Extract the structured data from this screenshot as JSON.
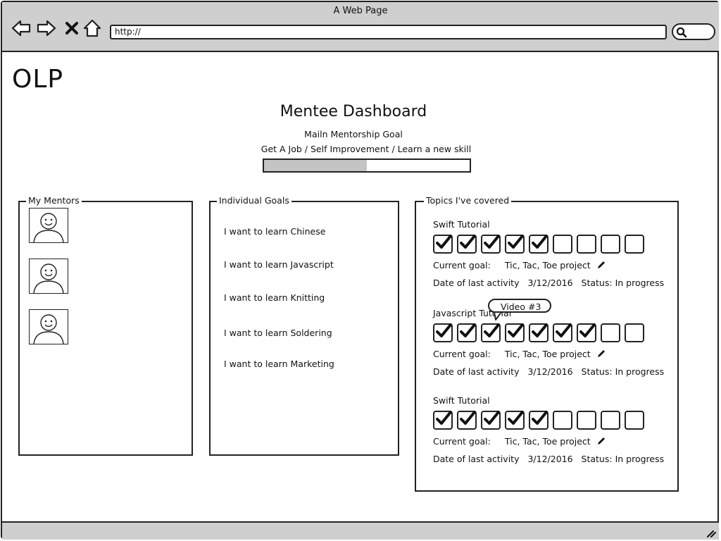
{
  "window": {
    "title": "A Web Page",
    "url": "http://"
  },
  "app": {
    "logo": "OLP",
    "dashboard_title": "Mentee Dashboard",
    "main_goal_label": "Mailn Mentorship Goal",
    "main_goal_text": "Get A Job  / Self Improvement / Learn a new skill",
    "main_goal_progress": 0.5
  },
  "mentors": {
    "legend": "My Mentors",
    "count": 3
  },
  "goals": {
    "legend": "Individual Goals",
    "items": [
      "I want to learn Chinese",
      "I want to learn Javascript",
      "I want to learn Knitting",
      "I want to learn Soldering",
      "I want to learn Marketing"
    ]
  },
  "topics": {
    "legend": "Topics I've covered",
    "items": [
      {
        "title": "Swift Tutorial",
        "checked": 5,
        "total": 9,
        "current_goal_label": "Current goal:",
        "current_goal": "Tic, Tac, Toe project",
        "date_label": "Date of last activity",
        "date": "3/12/2016",
        "status_label": "Status:",
        "status": "In progress"
      },
      {
        "title": "Javascript Tutorial",
        "checked": 7,
        "total": 9,
        "current_goal_label": "Current goal:",
        "current_goal": "Tic, Tac, Toe project",
        "date_label": "Date of last activity",
        "date": "3/12/2016",
        "status_label": "Status:",
        "status": "In progress"
      },
      {
        "title": "Swift Tutorial",
        "checked": 5,
        "total": 9,
        "current_goal_label": "Current goal:",
        "current_goal": "Tic, Tac, Toe project",
        "date_label": "Date of last activity",
        "date": "3/12/2016",
        "status_label": "Status:",
        "status": "In progress"
      }
    ],
    "tooltip": "Video #3"
  },
  "icons": {
    "back": "back-arrow-icon",
    "forward": "forward-arrow-icon",
    "stop": "close-icon",
    "home": "home-icon",
    "search": "search-icon",
    "edit": "pencil-icon",
    "mentor": "avatar-icon",
    "resize": "resize-grip-icon"
  }
}
